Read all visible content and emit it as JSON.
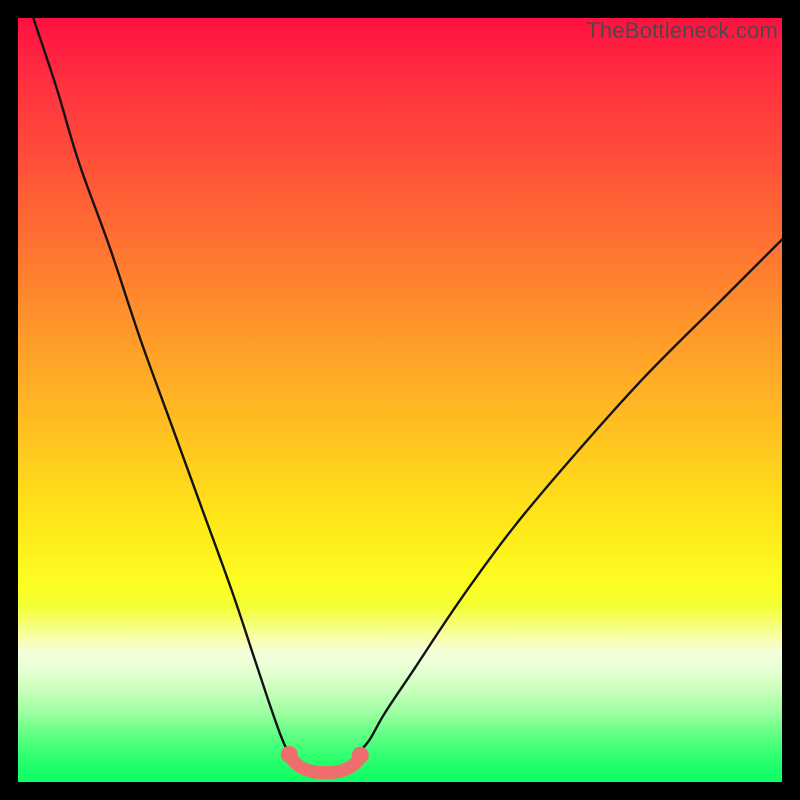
{
  "watermark": "TheBottleneck.com",
  "colors": {
    "bg": "#000000",
    "curve_stroke": "#131313",
    "marker_stroke": "#ee6e6e",
    "marker_fill": "#ee6e6e",
    "gradient_top": "#ff1041",
    "gradient_bottom": "#0bff63"
  },
  "chart_data": {
    "type": "line",
    "title": "",
    "xlabel": "",
    "ylabel": "",
    "xlim": [
      0,
      100
    ],
    "ylim": [
      0,
      100
    ],
    "grid": false,
    "legend": false,
    "series": [
      {
        "name": "left-curve",
        "x": [
          2.0,
          5.0,
          8.0,
          12.0,
          16.0,
          20.0,
          24.0,
          28.0,
          31.0,
          33.0,
          34.5,
          35.5
        ],
        "values": [
          100,
          91,
          81,
          70,
          58,
          47,
          36,
          25,
          16,
          10,
          5.8,
          3.6
        ]
      },
      {
        "name": "right-curve",
        "x": [
          44.5,
          46.0,
          48.0,
          52.0,
          58.0,
          65.0,
          73.0,
          82.0,
          92.0,
          100.0
        ],
        "values": [
          3.8,
          5.5,
          9.0,
          15.0,
          24.0,
          33.5,
          43.0,
          53.0,
          63.0,
          71.0
        ]
      },
      {
        "name": "bottom-markers",
        "x": [
          35.5,
          36.2,
          37.1,
          38.2,
          39.5,
          41.0,
          42.3,
          43.4,
          44.3,
          44.8
        ],
        "values": [
          3.6,
          2.6,
          1.9,
          1.45,
          1.25,
          1.25,
          1.45,
          1.9,
          2.6,
          3.5
        ]
      }
    ]
  }
}
